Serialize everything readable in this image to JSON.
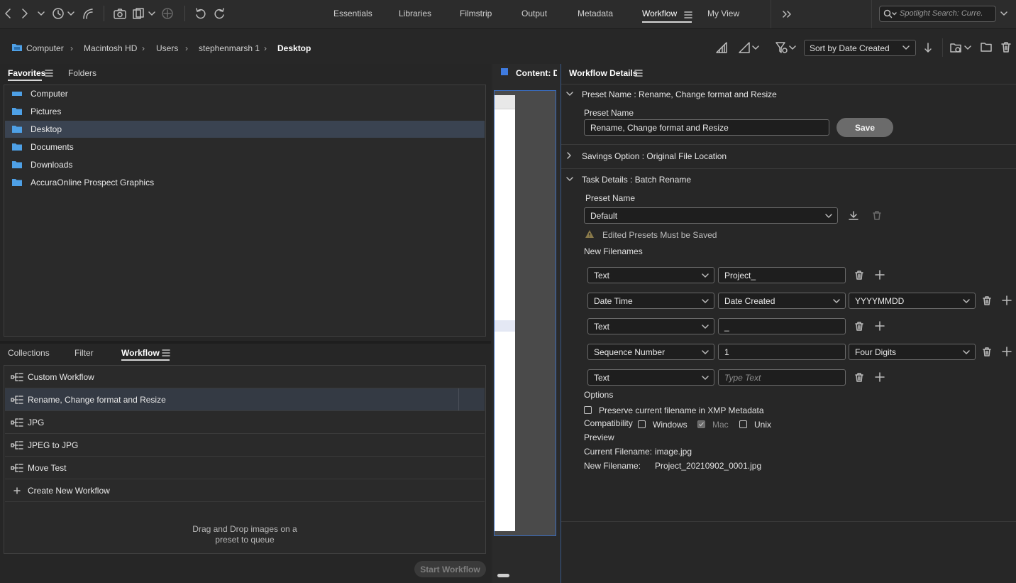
{
  "workspace_tabs": [
    "Essentials",
    "Libraries",
    "Filmstrip",
    "Output",
    "Metadata",
    "Workflow",
    "My View"
  ],
  "active_workspace": "Workflow",
  "search": {
    "placeholder": "Spotlight Search: Curre."
  },
  "breadcrumb": [
    "Computer",
    "Macintosh HD",
    "Users",
    "stephenmarsh 1",
    "Desktop"
  ],
  "sort": {
    "value": "Sort by Date Created"
  },
  "favorites_panel": {
    "tabs": [
      "Favorites",
      "Folders"
    ],
    "items": [
      "Computer",
      "Pictures",
      "Desktop",
      "Documents",
      "Downloads",
      "AccuraOnline Prospect Graphics"
    ],
    "selected": "Desktop"
  },
  "workflow_panel": {
    "tabs": [
      "Collections",
      "Filter",
      "Workflow"
    ],
    "items": [
      "Custom Workflow",
      "Rename, Change format and Resize",
      "JPG",
      "JPEG to JPG",
      "Move Test"
    ],
    "create_label": "Create New Workflow",
    "drop_hint_1": "Drag and Drop images on a",
    "drop_hint_2": "preset to queue",
    "start_label": "Start Workflow"
  },
  "content_panel": {
    "title": "Content: De"
  },
  "details": {
    "title": "Workflow Details",
    "preset_section": "Preset Name : Rename, Change format and Resize",
    "preset_label": "Preset Name",
    "preset_value": "Rename, Change format and Resize",
    "save_label": "Save",
    "savings_section": "Savings Option : Original File Location",
    "task_section": "Task Details : Batch Rename",
    "task_preset_label": "Preset Name",
    "task_preset_value": "Default",
    "warning": "Edited Presets Must be Saved",
    "new_filenames_label": "New Filenames",
    "rows": [
      {
        "type": "Text",
        "field": "Project_"
      },
      {
        "type": "Date Time",
        "field": "Date Created",
        "format": "YYYYMMDD"
      },
      {
        "type": "Text",
        "field": "_"
      },
      {
        "type": "Sequence Number",
        "field": "1",
        "format": "Four Digits"
      },
      {
        "type": "Text",
        "placeholder": "Type Text"
      }
    ],
    "options_label": "Options",
    "preserve_label": "Preserve current filename in XMP Metadata",
    "compat_label": "Compatibility",
    "compat_windows": "Windows",
    "compat_mac": "Mac",
    "compat_unix": "Unix",
    "preview_label": "Preview",
    "current_label": "Current Filename:",
    "current_value": "image.jpg",
    "new_label": "New Filename:",
    "new_value": "Project_20210902_0001.jpg"
  }
}
